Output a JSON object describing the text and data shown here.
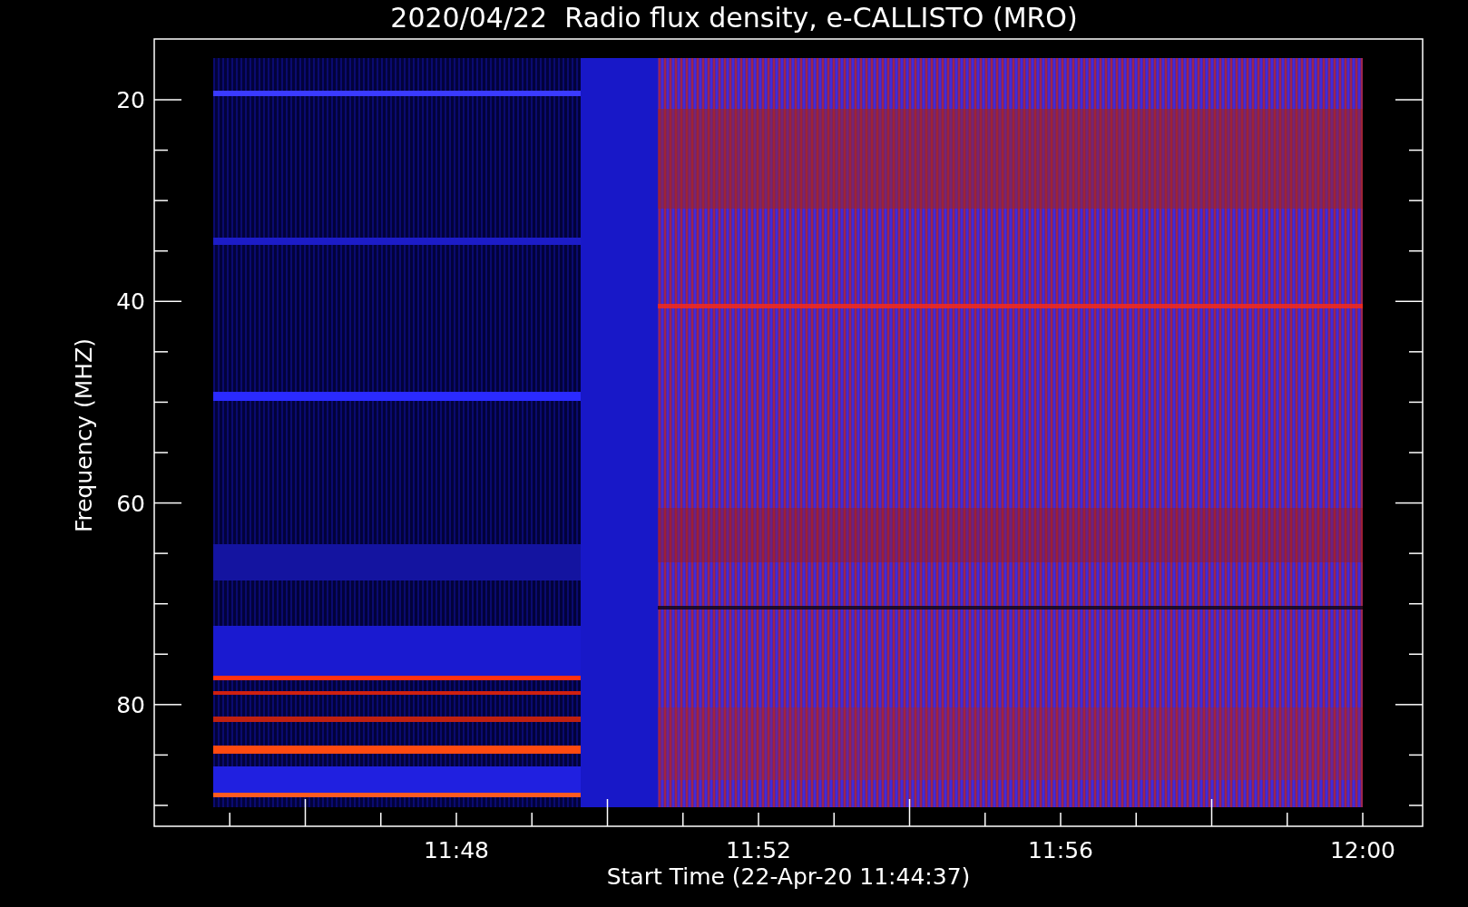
{
  "title": "2020/04/22  Radio flux density, e-CALLISTO (MRO)",
  "chart": {
    "ylabel": "Frequency (MHZ)",
    "xlabel": "Start Time (22-Apr-20 11:44:37)",
    "yticks": [
      "20",
      "40",
      "60",
      "80"
    ],
    "xticks": [
      "11:48",
      "11:52",
      "11:56",
      "12:00"
    ]
  }
}
